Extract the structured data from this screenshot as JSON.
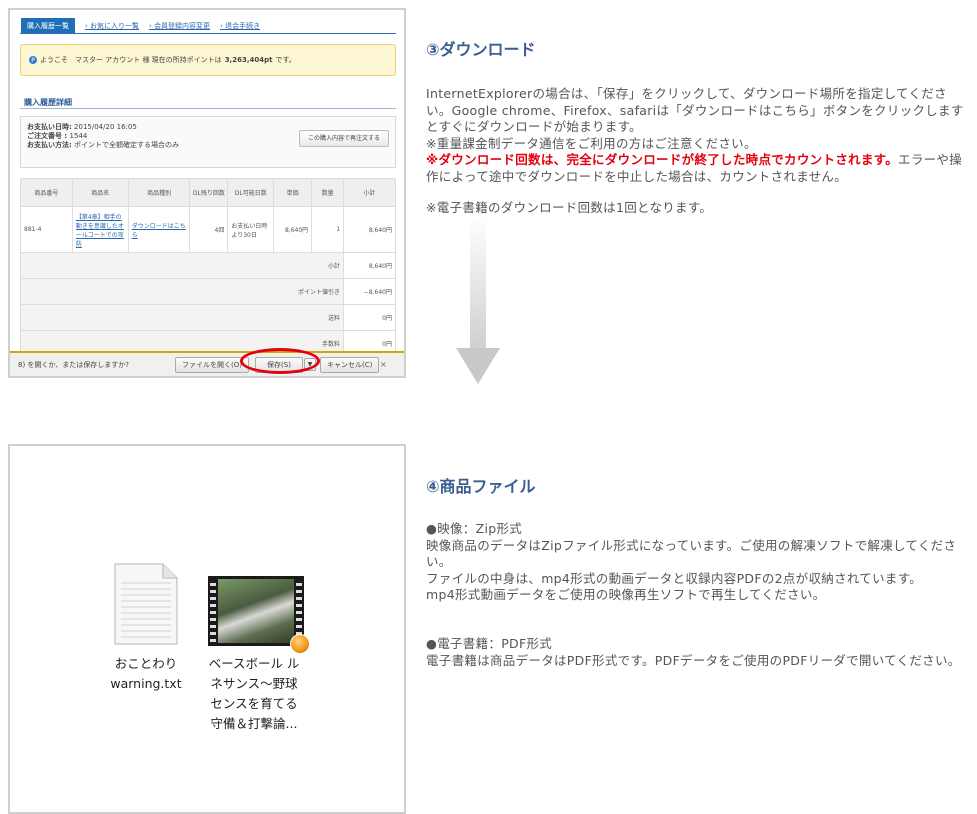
{
  "section3": {
    "heading": "③ダウンロード",
    "p1": "InternetExplorerの場合は、「保存」をクリックして、ダウンロード場所を指定してください。Google chrome、Firefox、safariは「ダウンロードはこちら」ボタンをクリックしますとすぐにダウンロードが始まります。",
    "p2": "※重量課金制データ通信をご利用の方はご注意ください。",
    "p3_red": "※ダウンロード回数は、完全にダウンロードが終了した時点でカウントされます。",
    "p3_rest": "エラーや操作によって途中でダウンロードを中止した場合は、カウントされません。",
    "p4": "※電子書籍のダウンロード回数は1回となります。"
  },
  "section4": {
    "heading": "④商品ファイル",
    "b1_title": "●映像：Zip形式",
    "b1_text": "映像商品のデータはZipファイル形式になっています。ご使用の解凍ソフトで解凍してください。\nファイルの中身は、mp4形式の動画データと収録内容PDFの2点が収納されています。\nmp4形式動画データをご使用の映像再生ソフトで再生してください。",
    "b2_title": "●電子書籍：PDF形式",
    "b2_text": "電子書籍は商品データはPDF形式です。PDFデータをご使用のPDFリーダで開いてください。"
  },
  "shot1": {
    "nav": [
      "購入履歴一覧",
      "お気に入り一覧",
      "会員登録内容変更",
      "退会手続き"
    ],
    "welcome_prefix": "ようこそ　マスター アカウント 様 現在の所持ポイントは",
    "points": "3,263,404pt",
    "welcome_suffix": "です。",
    "section_title": "購入履歴詳細",
    "order_date_label": "お支払い日時:",
    "order_date": "2015/04/20 16:05",
    "order_no_label": "ご注文番号 :",
    "order_no": "1544",
    "pay_label": "お支払い方法:",
    "pay": "ポイントで全額確定する場合のみ",
    "reorder": "この購入内容で再注文する",
    "headers": [
      "商品番号",
      "商品名",
      "商品種別",
      "DL残り回数",
      "DL可能日数",
      "単価",
      "数量",
      "小計"
    ],
    "row": [
      "881-4",
      "【第4章】相手の動きを意識したオールコートでの攻防",
      "ダウンロードはこちら",
      "4回",
      "お支払い日時より30日",
      "8,640円",
      "1",
      "8,640円"
    ],
    "sums": [
      {
        "label": "小計",
        "value": "8,640円"
      },
      {
        "label": "ポイント値引き",
        "value": "−8,640円"
      },
      {
        "label": "送料",
        "value": "0円"
      },
      {
        "label": "手数料",
        "value": "0円"
      }
    ],
    "dl_question": "8) を開くか、または保存しますか?",
    "open_btn": "ファイルを開く(O)",
    "save_btn": "保存(S)",
    "drop_btn": "▼",
    "cancel_btn": "キャンセル(C)",
    "close_btn": "×"
  },
  "shot2": {
    "file1_line1": "おことわり",
    "file1_line2": "warning.txt",
    "file2_lines": [
      "ベースボール ル",
      "ネサンス〜野球",
      "センスを育てる",
      "守備＆打撃論..."
    ]
  }
}
